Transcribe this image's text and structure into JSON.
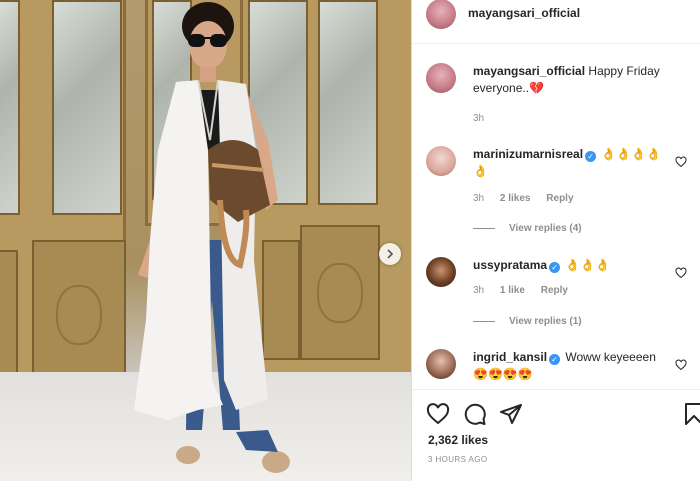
{
  "post": {
    "username": "mayangsari_official",
    "caption_user": "mayangsari_official",
    "caption_text": "Happy Friday everyone..",
    "caption_emoji": "💔",
    "caption_age": "3h"
  },
  "comments": [
    {
      "username": "marinizumarnisreal",
      "verified": true,
      "text": "👌👌👌👌👌",
      "age": "3h",
      "likes": "2 likes",
      "reply_label": "Reply",
      "view_replies": "View replies (4)"
    },
    {
      "username": "ussypratama",
      "verified": true,
      "text": "👌👌👌",
      "age": "3h",
      "likes": "1 like",
      "reply_label": "Reply",
      "view_replies": "View replies (1)"
    },
    {
      "username": "ingrid_kansil",
      "verified": true,
      "text": "Woww keyeeeen 😍😍😍😍"
    }
  ],
  "footer": {
    "likes": "2,362 likes",
    "timestamp": "3 HOURS AGO"
  },
  "icons": {
    "like": "heart-icon",
    "comment": "comment-icon",
    "share": "share-icon",
    "save": "bookmark-icon",
    "next": "chevron-right-icon"
  },
  "colors": {
    "verified": "#3897f0",
    "muted": "#8e8e8e",
    "text": "#262626"
  }
}
